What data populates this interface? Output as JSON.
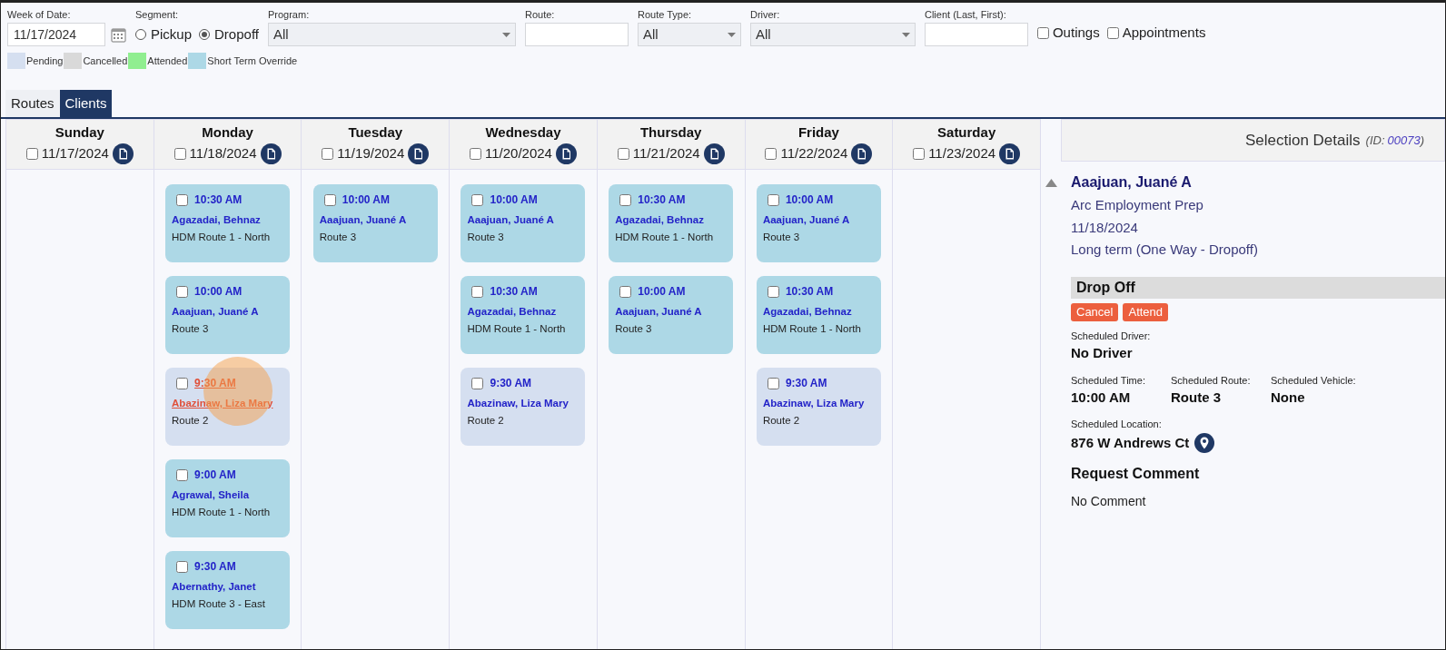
{
  "filters": {
    "week_of_date": {
      "label": "Week of Date:",
      "value": "11/17/2024"
    },
    "segment": {
      "label": "Segment:",
      "options": [
        {
          "label": "Pickup",
          "selected": false
        },
        {
          "label": "Dropoff",
          "selected": true
        }
      ]
    },
    "program": {
      "label": "Program:",
      "value": "All"
    },
    "route": {
      "label": "Route:"
    },
    "route_type": {
      "label": "Route Type:",
      "value": "All"
    },
    "driver": {
      "label": "Driver:",
      "value": "All"
    },
    "client": {
      "label": "Client (Last, First):"
    },
    "toggles": [
      {
        "label": "Outings",
        "checked": false
      },
      {
        "label": "Appointments",
        "checked": false
      }
    ]
  },
  "legend": [
    {
      "label": "Pending",
      "color": "#d5dff0"
    },
    {
      "label": "Cancelled",
      "color": "#d9d9d9"
    },
    {
      "label": "Attended",
      "color": "#90ee90"
    },
    {
      "label": "Short Term Override",
      "color": "#add8e6"
    }
  ],
  "tabs": [
    {
      "label": "Routes",
      "selected": false
    },
    {
      "label": "Clients",
      "selected": true
    }
  ],
  "days": [
    {
      "name": "Sunday",
      "date": "11/17/2024",
      "checked": false
    },
    {
      "name": "Monday",
      "date": "11/18/2024",
      "checked": false,
      "appointments": [
        {
          "time": "10:30 AM",
          "client": "Agazadai, Behnaz",
          "route": "HDM Route 1 - North",
          "color": "#add8e6",
          "checked": false,
          "hovered": false
        },
        {
          "time": "10:00 AM",
          "client": "Aaajuan, Juané A",
          "route": "Route 3",
          "color": "#add8e6",
          "checked": false,
          "hovered": false
        },
        {
          "time": "9:30 AM",
          "client": "Abazinaw, Liza Mary",
          "route": "Route 2",
          "color": "#d5dff0",
          "checked": false,
          "hovered": true
        },
        {
          "time": "9:00 AM",
          "client": "Agrawal, Sheila",
          "route": "HDM Route 1 - North",
          "color": "#add8e6",
          "checked": false,
          "hovered": false
        },
        {
          "time": "9:30 AM",
          "client": "Abernathy, Janet",
          "route": "HDM Route 3 - East",
          "color": "#add8e6",
          "checked": false,
          "hovered": false
        }
      ]
    },
    {
      "name": "Tuesday",
      "date": "11/19/2024",
      "checked": false,
      "appointments": [
        {
          "time": "10:00 AM",
          "client": "Aaajuan, Juané A",
          "route": "Route 3",
          "color": "#add8e6",
          "checked": false,
          "hovered": false
        }
      ]
    },
    {
      "name": "Wednesday",
      "date": "11/20/2024",
      "checked": false,
      "appointments": [
        {
          "time": "10:00 AM",
          "client": "Aaajuan, Juané A",
          "route": "Route 3",
          "color": "#add8e6",
          "checked": false,
          "hovered": false
        },
        {
          "time": "10:30 AM",
          "client": "Agazadai, Behnaz",
          "route": "HDM Route 1 - North",
          "color": "#add8e6",
          "checked": false,
          "hovered": false
        },
        {
          "time": "9:30 AM",
          "client": "Abazinaw, Liza Mary",
          "route": "Route 2",
          "color": "#d5dff0",
          "checked": false,
          "hovered": false
        }
      ]
    },
    {
      "name": "Thursday",
      "date": "11/21/2024",
      "checked": false,
      "appointments": [
        {
          "time": "10:30 AM",
          "client": "Agazadai, Behnaz",
          "route": "HDM Route 1 - North",
          "color": "#add8e6",
          "checked": false,
          "hovered": false
        },
        {
          "time": "10:00 AM",
          "client": "Aaajuan, Juané A",
          "route": "Route 3",
          "color": "#add8e6",
          "checked": false,
          "hovered": false
        }
      ]
    },
    {
      "name": "Friday",
      "date": "11/22/2024",
      "checked": false,
      "appointments": [
        {
          "time": "10:00 AM",
          "client": "Aaajuan, Juané A",
          "route": "Route 3",
          "color": "#add8e6",
          "checked": false,
          "hovered": false
        },
        {
          "time": "10:30 AM",
          "client": "Agazadai, Behnaz",
          "route": "HDM Route 1 - North",
          "color": "#add8e6",
          "checked": false,
          "hovered": false
        },
        {
          "time": "9:30 AM",
          "client": "Abazinaw, Liza Mary",
          "route": "Route 2",
          "color": "#d5dff0",
          "checked": false,
          "hovered": false
        }
      ]
    },
    {
      "name": "Saturday",
      "date": "11/23/2024",
      "checked": false
    }
  ],
  "details": {
    "title": "Selection Details",
    "id_label": "(ID:",
    "id": "00073",
    "id_close": ")",
    "client": "Aaajuan, Juané A",
    "program": "Arc Employment Prep",
    "date": "11/18/2024",
    "type": "Long term (One Way - Dropoff)",
    "section": "Drop Off",
    "buttons": [
      "Cancel",
      "Attend"
    ],
    "driver": {
      "label": "Scheduled Driver:",
      "value": "No Driver"
    },
    "schedule": [
      {
        "label": "Scheduled Time:",
        "value": "10:00 AM"
      },
      {
        "label": "Scheduled Route:",
        "value": "Route 3"
      },
      {
        "label": "Scheduled Vehicle:",
        "value": "None"
      }
    ],
    "location": {
      "label": "Scheduled Location:",
      "value": "876 W Andrews Ct"
    },
    "comment": {
      "heading": "Request Comment",
      "value": "No Comment"
    }
  }
}
